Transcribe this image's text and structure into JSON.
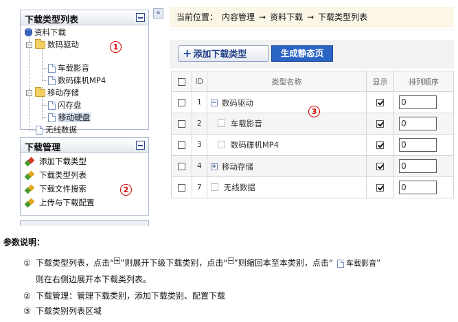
{
  "panels": {
    "category_list": {
      "title": "下载类型列表",
      "tree": {
        "root": "资料下载",
        "folder1": "数码驱动",
        "folder1_items": [
          "车载影音",
          "数码碟机MP4"
        ],
        "folder2": "移动存储",
        "folder2_items": [
          "闪存盘",
          "移动硬盘"
        ],
        "leaf": "无线数据"
      }
    },
    "download_manage": {
      "title": "下载管理",
      "items": [
        "添加下载类型",
        "下载类型列表",
        "下载文件搜索",
        "上传与下载配置"
      ]
    }
  },
  "collapse_arrow": "«",
  "markers": {
    "one": "1",
    "two": "2",
    "three": "3"
  },
  "breadcrumb": {
    "label": "当前位置：",
    "path": [
      "内容管理",
      "→",
      "资料下载",
      "→",
      "下载类型列表"
    ]
  },
  "toolbar": {
    "add_plus": "+",
    "add_label": "添加下载类型",
    "generate_label": "生成静态页"
  },
  "table": {
    "headers": {
      "id": "ID",
      "name": "类型名称",
      "show": "显示",
      "order": "排列顺序"
    },
    "rows": [
      {
        "id": "1",
        "name": "数码驱动",
        "toggle": "−",
        "show": true,
        "order": "0"
      },
      {
        "id": "2",
        "name": "车载影音",
        "show": true,
        "order": "0"
      },
      {
        "id": "3",
        "name": "数码碟机MP4",
        "show": true,
        "order": "0"
      },
      {
        "id": "4",
        "name": "移动存储",
        "toggle": "+",
        "show": true,
        "order": "0"
      },
      {
        "id": "7",
        "name": "无线数据",
        "show": true,
        "order": "0"
      }
    ]
  },
  "notes": {
    "title": "参数说明：",
    "items": [
      {
        "num": "①",
        "p1": "下载类型列表，点击“",
        "p2": "”则展开下级下载类别，点击“",
        "p3": "”则缩回本至本类别，点击“",
        "example": "车载影音",
        "p4": "”",
        "line2": "则在右侧边展开本下载类列表。"
      },
      {
        "num": "②",
        "text": "下载管理：管理下载类别，添加下载类别、配置下载"
      },
      {
        "num": "③",
        "text": "下载类别列表区域"
      }
    ]
  }
}
